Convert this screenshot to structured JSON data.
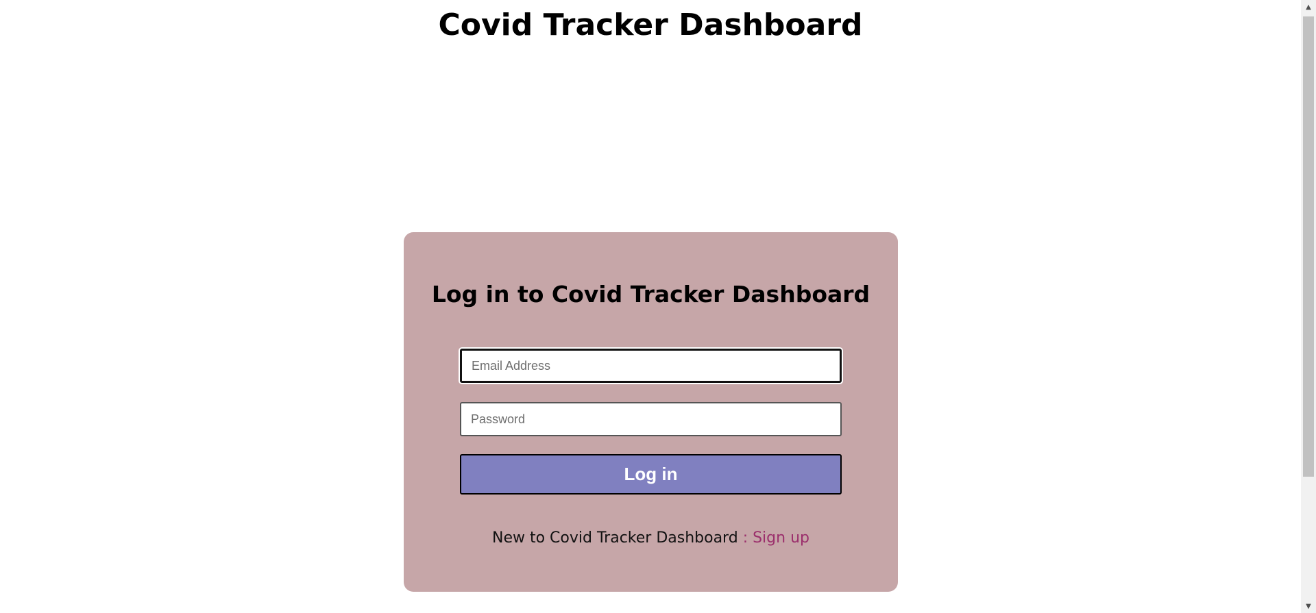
{
  "header": {
    "title": "Covid Tracker Dashboard"
  },
  "login_form": {
    "title": "Log in to Covid Tracker Dashboard",
    "email_placeholder": "Email Address",
    "password_placeholder": "Password",
    "submit_label": "Log in",
    "signup_prompt": "New to Covid Tracker Dashboard",
    "signup_link": ": Sign up"
  },
  "colors": {
    "card_background": "#c6a6a8",
    "button_background": "#8080c0",
    "signup_link": "#9b2f6c"
  },
  "scrollbar": {
    "up_icon": "triangle-up-icon",
    "down_icon": "triangle-down-icon"
  }
}
